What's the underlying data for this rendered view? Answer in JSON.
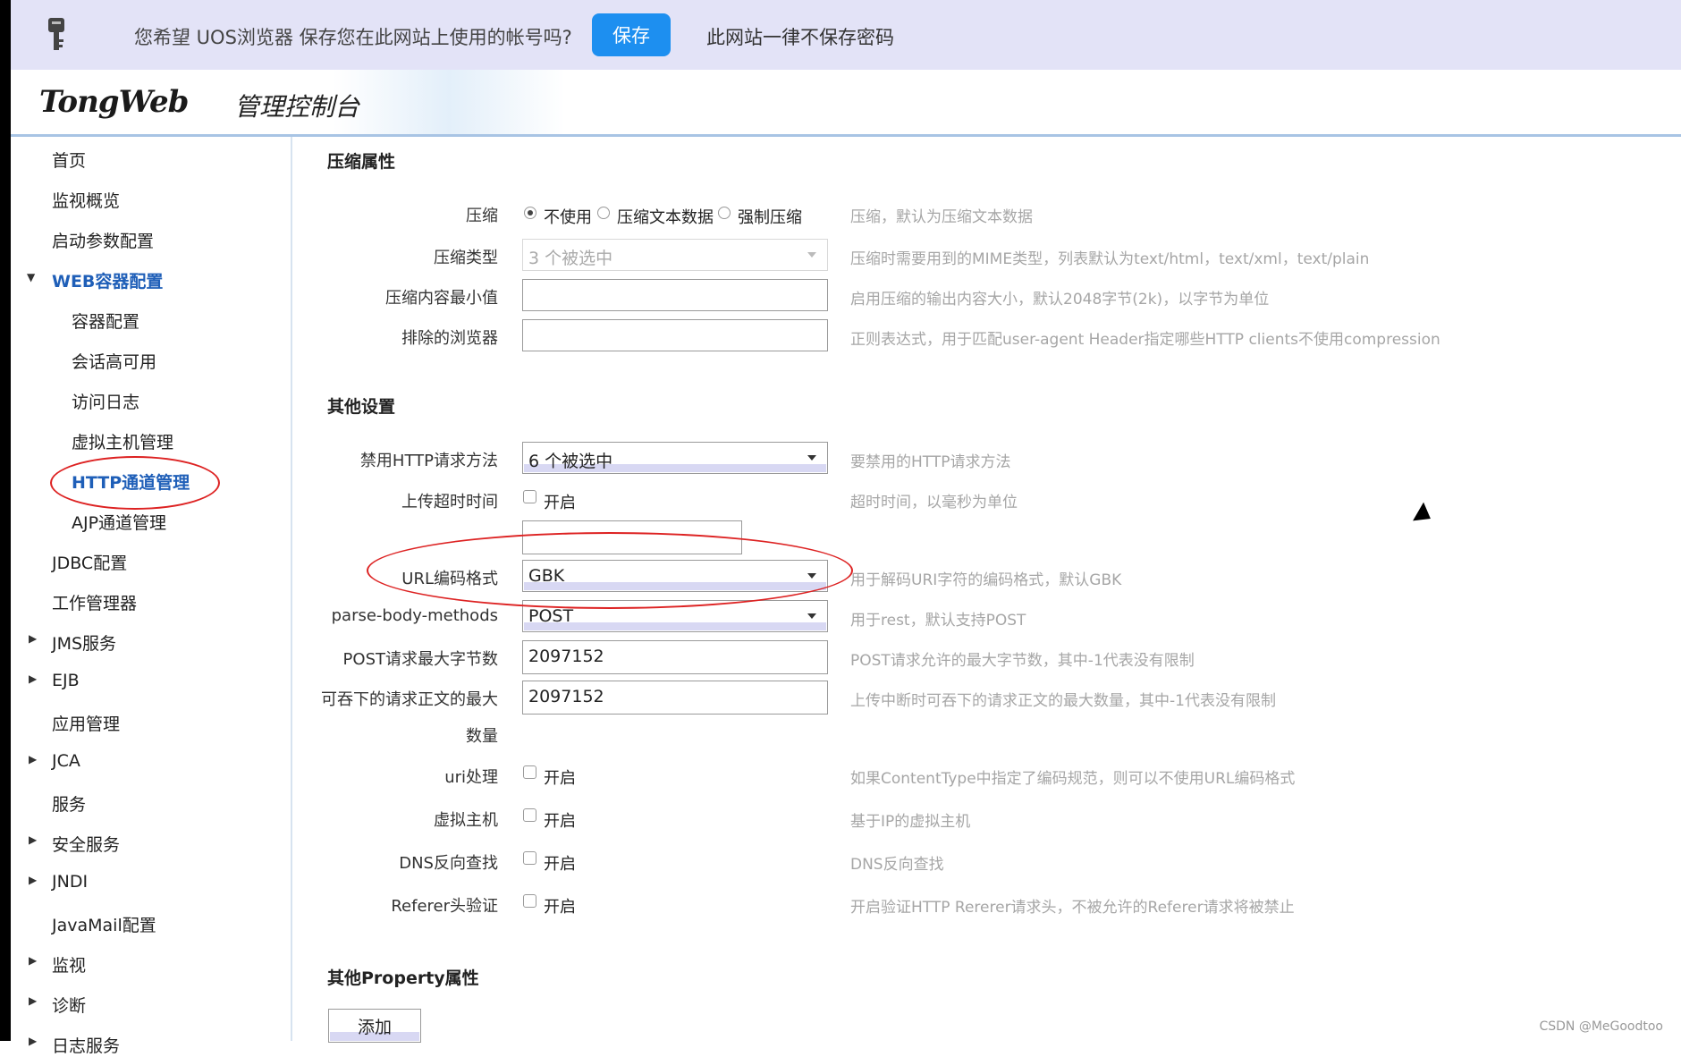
{
  "password_bar": {
    "prompt": "您希望 UOS浏览器 保存您在此网站上使用的帐号吗?",
    "save_label": "保存",
    "never_label": "此网站一律不保存密码",
    "icon": "key-icon"
  },
  "header": {
    "logo": "TongWeb",
    "subtitle": "管理控制台"
  },
  "sidebar": {
    "items": [
      {
        "label": "首页"
      },
      {
        "label": "监视概览"
      },
      {
        "label": "启动参数配置"
      },
      {
        "label": "WEB容器配置"
      },
      {
        "label": "容器配置"
      },
      {
        "label": "会话高可用"
      },
      {
        "label": "访问日志"
      },
      {
        "label": "虚拟主机管理"
      },
      {
        "label": "HTTP通道管理"
      },
      {
        "label": "AJP通道管理"
      },
      {
        "label": "JDBC配置"
      },
      {
        "label": "工作管理器"
      },
      {
        "label": "JMS服务"
      },
      {
        "label": "EJB"
      },
      {
        "label": "应用管理"
      },
      {
        "label": "JCA"
      },
      {
        "label": "服务"
      },
      {
        "label": "安全服务"
      },
      {
        "label": "JNDI"
      },
      {
        "label": "JavaMail配置"
      },
      {
        "label": "监视"
      },
      {
        "label": "诊断"
      },
      {
        "label": "日志服务"
      }
    ]
  },
  "compression": {
    "title": "压缩属性",
    "compress": {
      "label": "压缩",
      "options": [
        "不使用",
        "压缩文本数据",
        "强制压缩"
      ],
      "selected": "不使用",
      "hint": "压缩，默认为压缩文本数据"
    },
    "type": {
      "label": "压缩类型",
      "value": "3 个被选中",
      "hint": "压缩时需要用到的MIME类型，列表默认为text/html，text/xml，text/plain"
    },
    "min_size": {
      "label": "压缩内容最小值",
      "value": "",
      "hint": "启用压缩的输出内容大小，默认2048字节(2k)，以字节为单位"
    },
    "excluded_browsers": {
      "label": "排除的浏览器",
      "value": "",
      "hint": "正则表达式，用于匹配user-agent Header指定哪些HTTP clients不使用compression"
    }
  },
  "other": {
    "title": "其他设置",
    "disabled_methods": {
      "label": "禁用HTTP请求方法",
      "value": "6 个被选中",
      "hint": "要禁用的HTTP请求方法"
    },
    "upload_timeout": {
      "label": "上传超时时间",
      "check_label": "开启",
      "value": "",
      "hint": "超时时间，以毫秒为单位"
    },
    "url_encoding": {
      "label": "URL编码格式",
      "value": "GBK",
      "hint": "用于解码URI字符的编码格式，默认GBK"
    },
    "parse_body": {
      "label": "parse-body-methods",
      "value": "POST",
      "hint": "用于rest，默认支持POST"
    },
    "post_max": {
      "label": "POST请求最大字节数",
      "value": "2097152",
      "hint": "POST请求允许的最大字节数，其中-1代表没有限制"
    },
    "swallow_max": {
      "label_line1": "可吞下的请求正文的最大",
      "label_line2": "数量",
      "value": "2097152",
      "hint": "上传中断时可吞下的请求正文的最大数量，其中-1代表没有限制"
    },
    "uri_handling": {
      "label": "uri处理",
      "check_label": "开启",
      "hint": "如果ContentType中指定了编码规范，则可以不使用URL编码格式"
    },
    "virtual_host": {
      "label": "虚拟主机",
      "check_label": "开启",
      "hint": "基于IP的虚拟主机"
    },
    "dns_lookup": {
      "label": "DNS反向查找",
      "check_label": "开启",
      "hint": "DNS反向查找"
    },
    "referer": {
      "label": "Referer头验证",
      "check_label": "开启",
      "hint": "开启验证HTTP Rererer请求头，不被允许的Referer请求将被禁止"
    }
  },
  "property": {
    "title": "其他Property属性",
    "add_label": "添加"
  },
  "watermark": "CSDN @MeGoodtoo",
  "colors": {
    "password_bar_bg": "#e3e3f7",
    "save_button": "#1d8ff0",
    "active_nav": "#1f5fb8",
    "annotation_circle": "#dd2222"
  }
}
